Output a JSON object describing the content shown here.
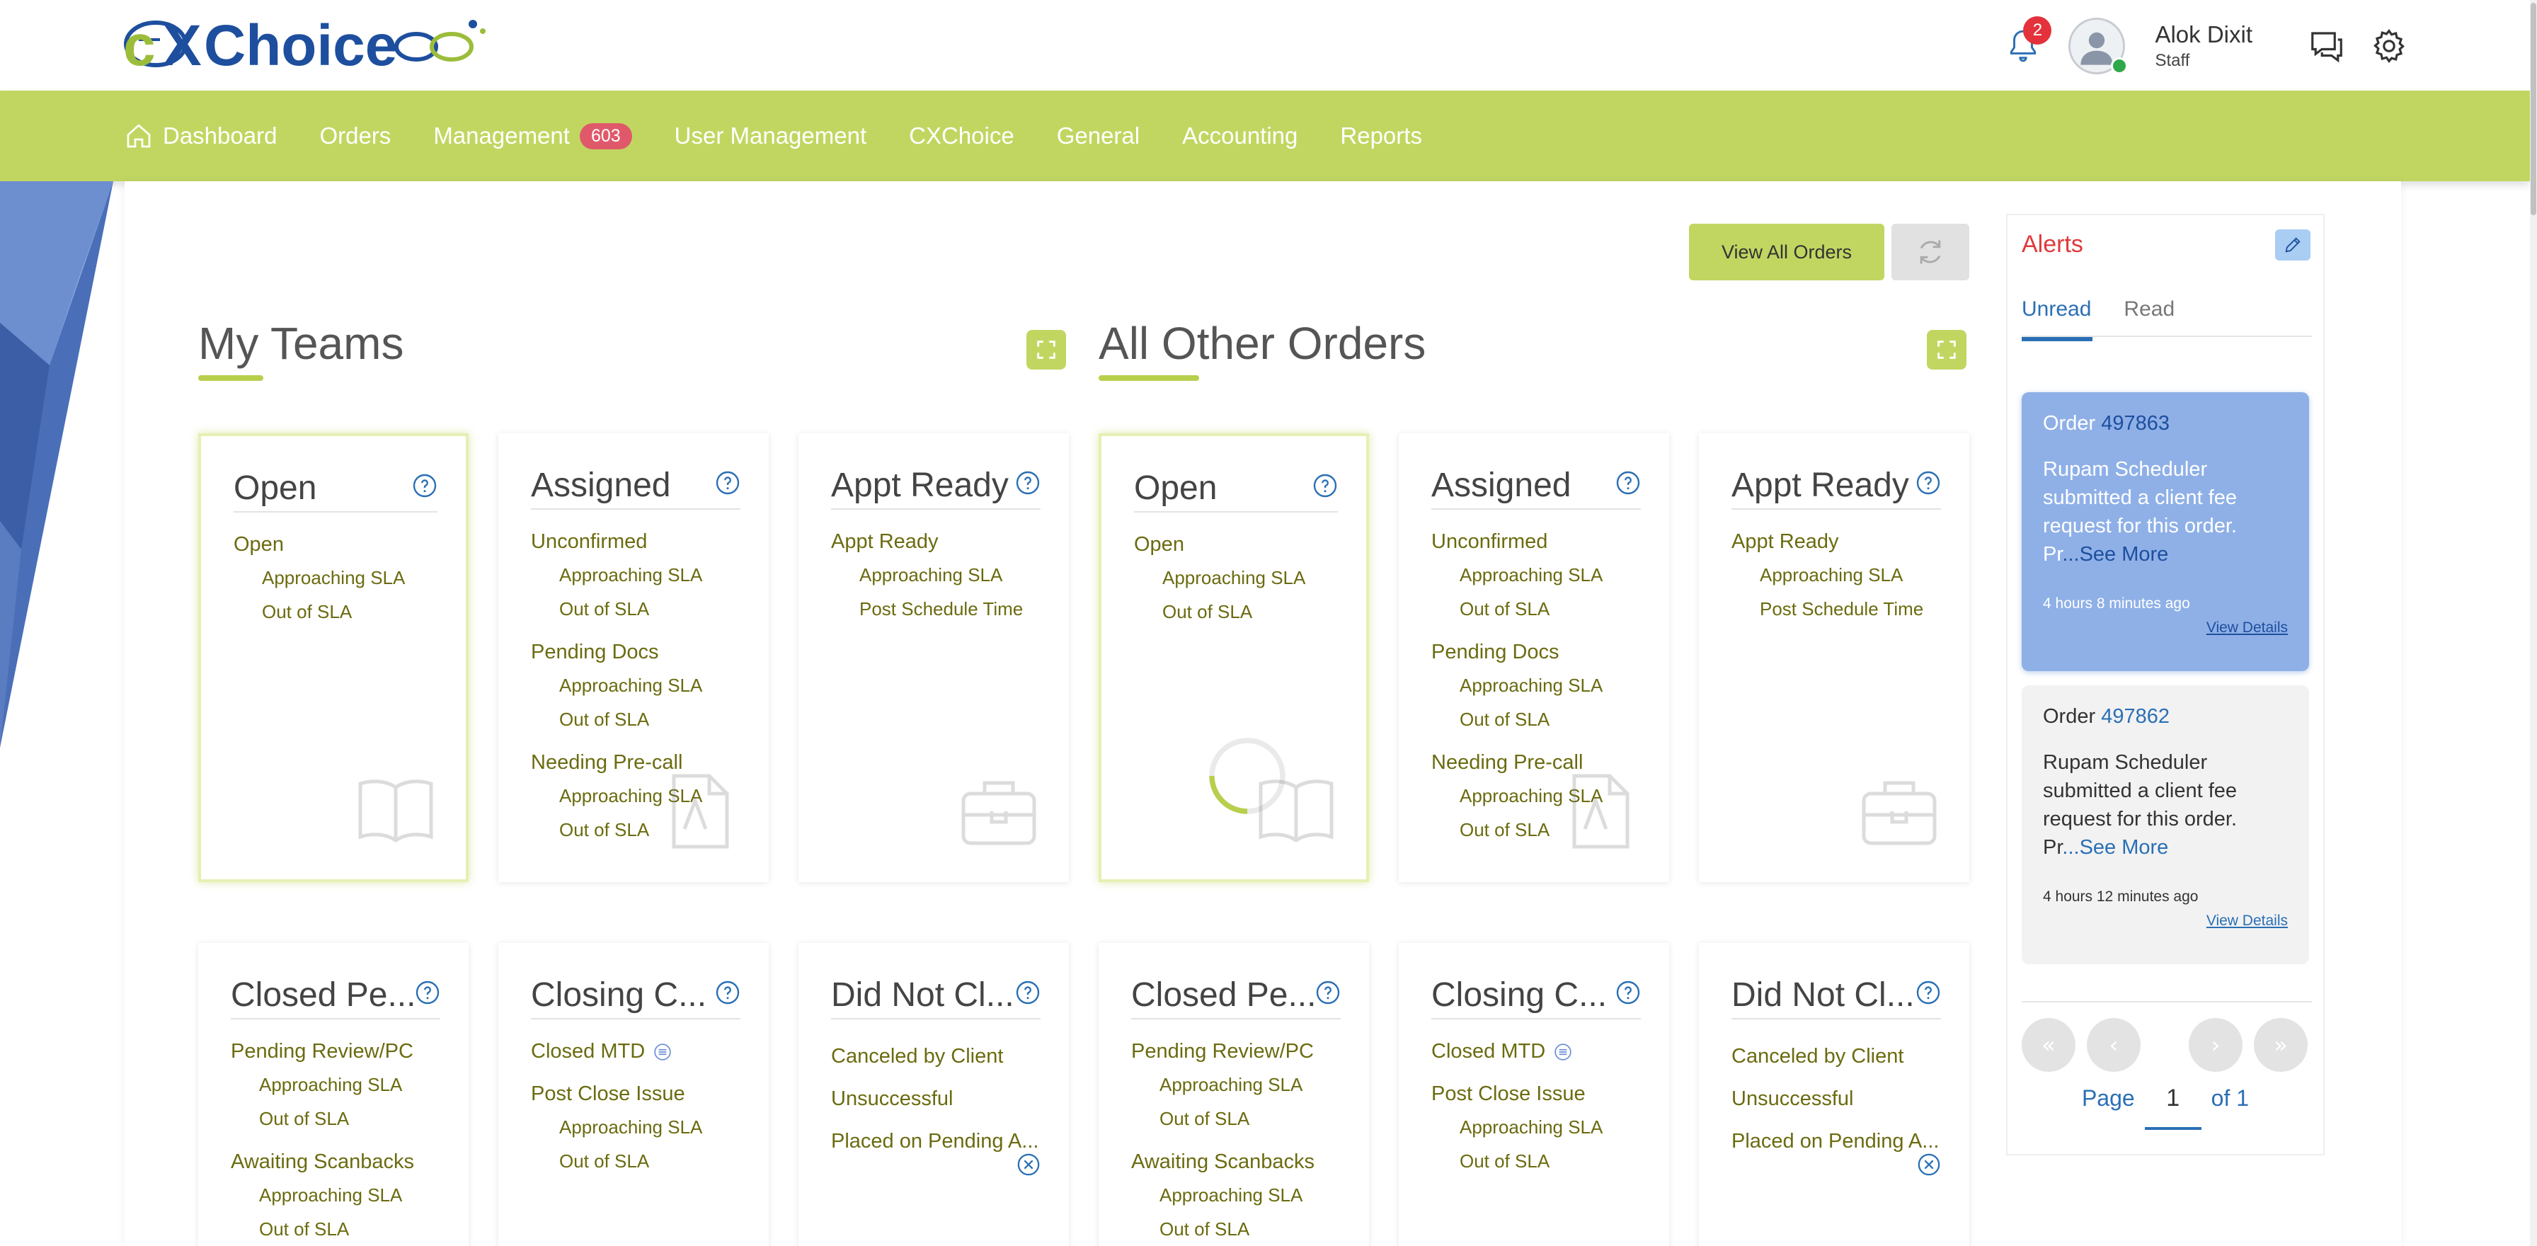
{
  "brand": {
    "logo_text": "CXChoice"
  },
  "header": {
    "notifications_count": "2",
    "user_name": "Alok Dixit",
    "user_role": "Staff"
  },
  "nav": {
    "dashboard": "Dashboard",
    "orders": "Orders",
    "management": "Management",
    "management_badge": "603",
    "user_management": "User Management",
    "cxchoice": "CXChoice",
    "general": "General",
    "accounting": "Accounting",
    "reports": "Reports"
  },
  "toolbar": {
    "view_all_orders": "View All Orders"
  },
  "sections": {
    "my_teams": "My Teams",
    "all_other_orders": "All Other Orders"
  },
  "cards": {
    "open": {
      "title": "Open",
      "group": "Open",
      "sub1": "Approaching SLA",
      "sub2": "Out of SLA"
    },
    "assigned": {
      "title": "Assigned",
      "g1": "Unconfirmed",
      "g1s1": "Approaching SLA",
      "g1s2": "Out of SLA",
      "g2": "Pending Docs",
      "g2s1": "Approaching SLA",
      "g2s2": "Out of SLA",
      "g3": "Needing Pre-call",
      "g3s1": "Approaching SLA",
      "g3s2": "Out of SLA"
    },
    "appt_ready": {
      "title": "Appt Ready",
      "group": "Appt Ready",
      "sub1": "Approaching SLA",
      "sub2": "Post Schedule Time"
    },
    "closed_pe": {
      "title": "Closed Pe...",
      "g1": "Pending Review/PC",
      "g1s1": "Approaching SLA",
      "g1s2": "Out of SLA",
      "g2": "Awaiting Scanbacks",
      "g2s1": "Approaching SLA",
      "g2s2": "Out of SLA"
    },
    "closing_c": {
      "title": "Closing C...",
      "g1": "Closed MTD",
      "g2": "Post Close Issue",
      "g2s1": "Approaching SLA",
      "g2s2": "Out of SLA"
    },
    "did_not_cl": {
      "title": "Did Not Cl...",
      "g1": "Canceled by Client",
      "g2": "Unsuccessful",
      "g3": "Placed on Pending A..."
    }
  },
  "alerts": {
    "title": "Alerts",
    "tab_unread": "Unread",
    "tab_read": "Read",
    "items": [
      {
        "order_label": "Order",
        "order_number": "497863",
        "message": "Rupam Scheduler submitted a client fee request for this order. Pr",
        "see_more": "...See More",
        "time": "4 hours 8 minutes ago",
        "details": "View Details"
      },
      {
        "order_label": "Order",
        "order_number": "497862",
        "message": "Rupam Scheduler submitted a client fee request for this order. Pr",
        "see_more": "...See More",
        "time": "4 hours 12 minutes ago",
        "details": "View Details"
      }
    ],
    "pager": {
      "page_label": "Page",
      "current": "1",
      "of_label": "of 1"
    }
  },
  "icons": {
    "bell": "bell-icon",
    "chat": "chat-icon",
    "settings": "gear-icon",
    "home": "home-icon",
    "refresh": "refresh-icon",
    "expand": "expand-icon",
    "help": "help-circle-icon",
    "edit": "pencil-icon",
    "book": "book-icon",
    "briefcase": "briefcase-icon",
    "document": "document-icon"
  },
  "colors": {
    "brand_green": "#c1d661",
    "alert_red": "#e0383b",
    "link_blue": "#2a6fb5",
    "alert_card_blue": "#8fb0e7"
  }
}
